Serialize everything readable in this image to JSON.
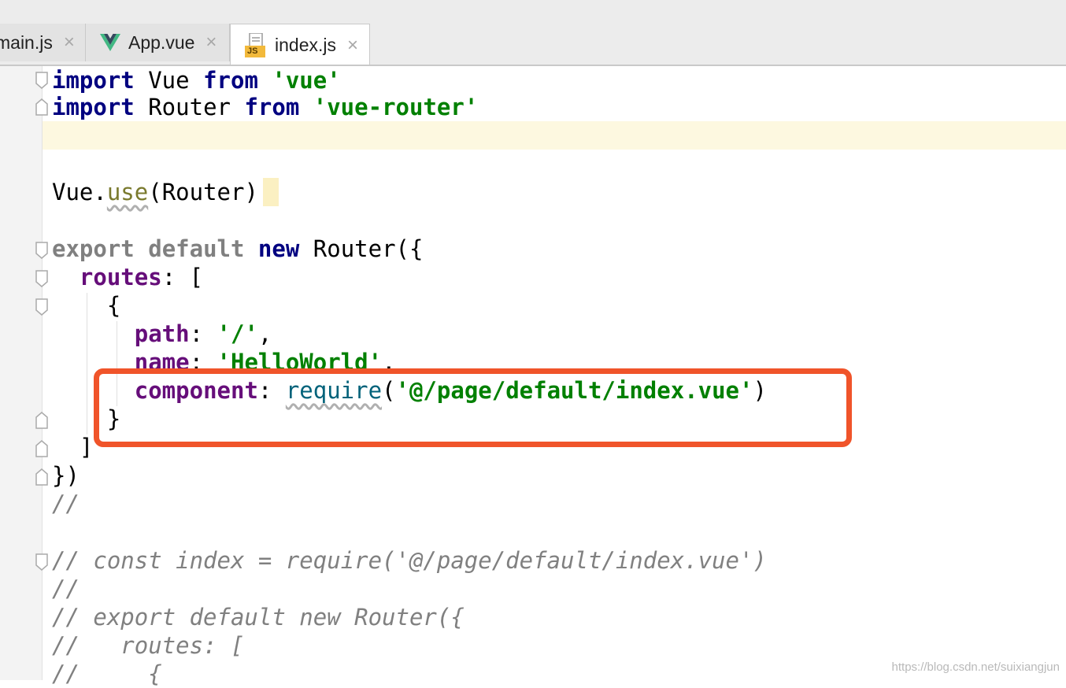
{
  "tabs": [
    {
      "label": "main.js",
      "icon": "js-icon",
      "active": false
    },
    {
      "label": "App.vue",
      "icon": "vue-icon",
      "active": false
    },
    {
      "label": "index.js",
      "icon": "js-file-icon",
      "active": true
    }
  ],
  "tab_close_glyph": "×",
  "js_badge": "JS",
  "colors": {
    "keyword": "#000080",
    "string": "#008000",
    "property": "#660e7a",
    "comment": "#808080",
    "highlight_box": "#f0542a"
  },
  "code": {
    "l1": {
      "kw": "import",
      "id": " Vue ",
      "kw2": "from",
      "sp": " ",
      "str": "'vue'"
    },
    "l2": {
      "kw": "import",
      "id": " Router ",
      "kw2": "from",
      "sp": " ",
      "str": "'vue-router'"
    },
    "l4": {
      "obj": "Vue.",
      "fn": "use",
      "rest": "(Router)"
    },
    "l6": {
      "ex1": "export",
      "sp": " ",
      "ex2": "default",
      "sp2": " ",
      "kw": "new",
      "rest": " Router({"
    },
    "l7": {
      "indent": "  ",
      "prop": "routes",
      "rest": ": ["
    },
    "l8": {
      "text": "    {"
    },
    "l9": {
      "indent": "      ",
      "prop": "path",
      "punct": ": ",
      "str": "'/'",
      "end": ","
    },
    "l10": {
      "indent": "      ",
      "prop": "name",
      "punct": ": ",
      "str": "'HelloWorld'",
      "end": ","
    },
    "l11": {
      "indent": "      ",
      "prop": "component",
      "punct": ": ",
      "fn": "require",
      "open": "(",
      "str": "'@/page/default/index.vue'",
      "close": ")"
    },
    "l12": {
      "text": "    }"
    },
    "l13": {
      "text": "  ]"
    },
    "l14": {
      "text": "})"
    },
    "l15": {
      "text": "//"
    },
    "l17": {
      "text": "// const index = require('@/page/default/index.vue')"
    },
    "l18": {
      "text": "//"
    },
    "l19": {
      "text": "// export default new Router({"
    },
    "l20": {
      "text": "//   routes: ["
    },
    "l21": {
      "text": "//     {"
    }
  },
  "watermark": "https://blog.csdn.net/suixiangjun"
}
